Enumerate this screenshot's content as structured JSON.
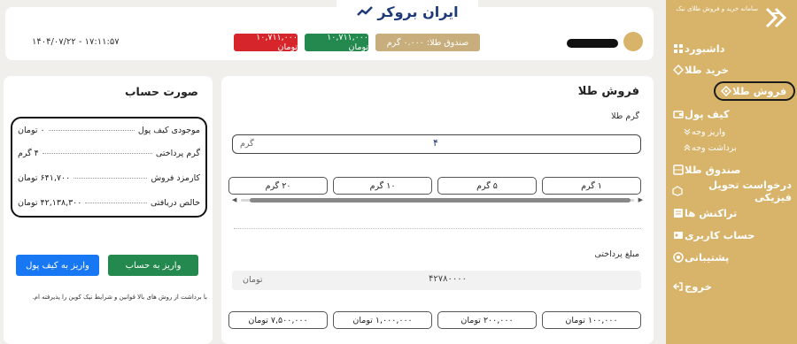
{
  "brand": {
    "name": "ایران بروکر"
  },
  "sidebar": {
    "logo_text": "سامانه خرید و فروش طلای نیک",
    "items": [
      {
        "label": "داشبورد",
        "icon": "dashboard-icon"
      },
      {
        "label": "خرید طلا",
        "icon": "gold-buy-icon"
      },
      {
        "label": "فروش طلا",
        "icon": "gold-sell-icon",
        "active": true
      },
      {
        "label": "کیف پول",
        "icon": "wallet-icon"
      },
      {
        "label": "واریز وجه",
        "icon": "deposit-icon",
        "sub": true
      },
      {
        "label": "برداشت وجه",
        "icon": "withdraw-icon",
        "sub": true
      },
      {
        "label": "صندوق طلا",
        "icon": "safe-icon"
      },
      {
        "label": "درخواست تحویل فیزیکی",
        "icon": "delivery-icon"
      },
      {
        "label": "تراکنش ها",
        "icon": "transactions-icon"
      },
      {
        "label": "حساب کاربری",
        "icon": "user-icon"
      },
      {
        "label": "پشتیبانی",
        "icon": "support-icon"
      },
      {
        "label": "خروج",
        "icon": "logout-icon"
      }
    ]
  },
  "header": {
    "datetime": "۱۴۰۴/۰۷/۲۲ - ۱۷:۱۱:۵۷",
    "price_red": "۱۰,۷۱۱,۰۰۰ تومان",
    "price_green": "۱۰,۷۱۱,۰۰۰ تومان",
    "gold_fund": "صندوق طلا: ۰.۰۰۰ گرم"
  },
  "sell": {
    "title": "فروش طلا",
    "gram_label": "گرم طلا",
    "gram_value": "۴",
    "gram_unit": "گرم",
    "gram_chips": [
      "۱ گرم",
      "۵ گرم",
      "۱۰ گرم",
      "۲۰ گرم"
    ],
    "amount_label": "مبلغ پرداختی",
    "amount_value": "۴۲۷۸۰۰۰۰",
    "amount_unit": "تومان",
    "amount_chips": [
      "۱۰۰,۰۰۰ تومان",
      "۲۰۰,۰۰۰ تومان",
      "۱,۰۰۰,۰۰۰ تومان",
      "۷,۵۰۰,۰۰۰ تومان"
    ]
  },
  "invoice": {
    "title": "صورت حساب",
    "rows": [
      {
        "label": "موجودی کیف پول",
        "value": "۰ تومان"
      },
      {
        "label": "گرم پرداختی",
        "value": "۴ گرم"
      },
      {
        "label": "کارمزد فروش",
        "value": "۶۴۱,۷۰۰ تومان"
      },
      {
        "label": "خالص دریافتی",
        "value": "۴۲,۱۳۸,۳۰۰ تومان"
      }
    ],
    "btn_to_account": "واریز به حساب",
    "btn_to_wallet": "واریز به کیف پول",
    "terms": "با برداشت از روش های بالا قوانین و شرایط نیک کوین را پذیرفته ام."
  },
  "colors": {
    "sidebar": "#d8b36a",
    "red": "#d6262b",
    "green": "#24894e",
    "blue": "#1877f2",
    "tan": "#c7ae7c"
  }
}
